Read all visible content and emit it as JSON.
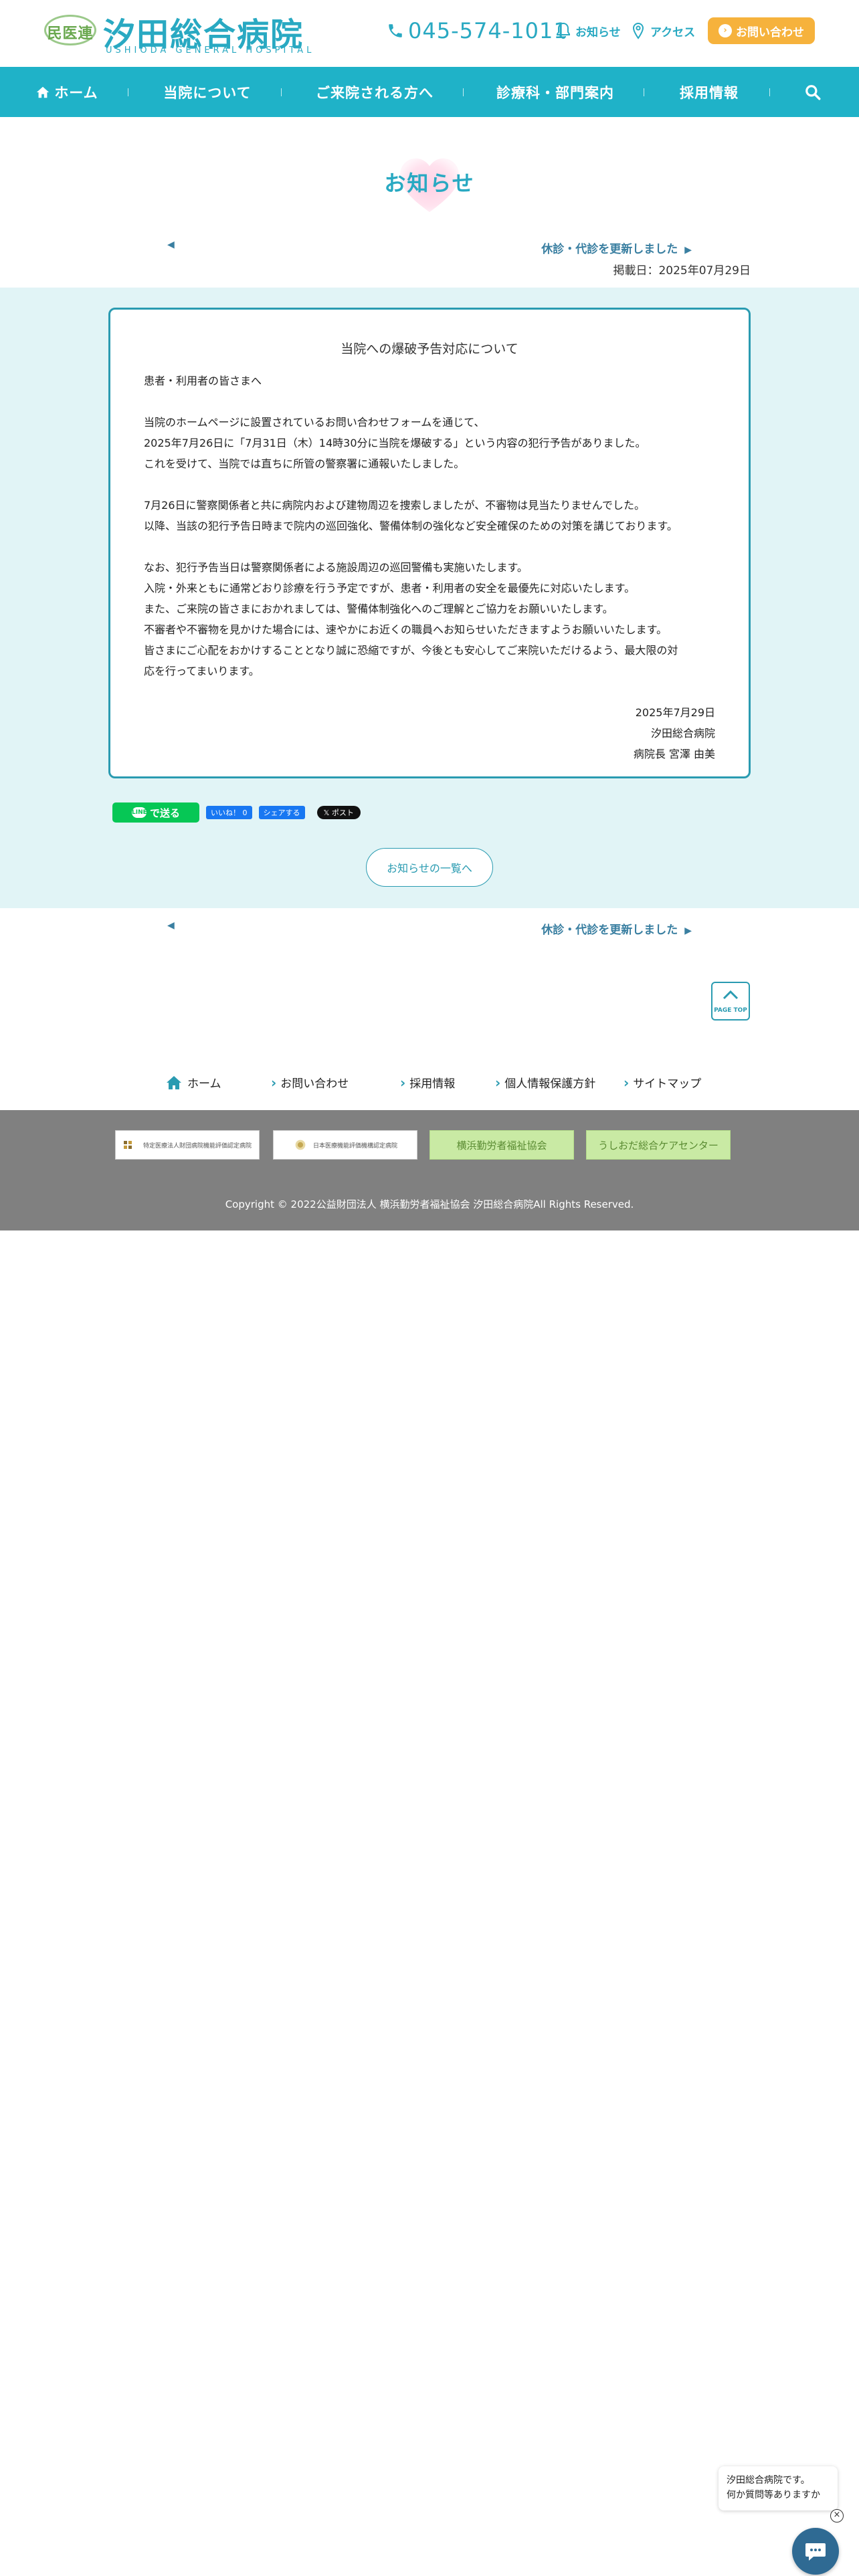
{
  "header": {
    "logo_badge": "民医連",
    "logo_name": "汐田総合病院",
    "logo_sub": "USHIODA GENERAL HOSPITAL",
    "tel": "045-574-1011",
    "news_label": "お知らせ",
    "access_label": "アクセス",
    "contact_label": "お問い合わせ",
    "contact_icon": "›"
  },
  "nav": {
    "items": [
      {
        "label": "ホーム"
      },
      {
        "label": "当院について"
      },
      {
        "label": "ご来院される方へ"
      },
      {
        "label": "診療科・部門案内"
      },
      {
        "label": "採用情報"
      }
    ]
  },
  "page": {
    "title": "お知らせ",
    "prev_arrow": "◀",
    "next_label": "休診・代診を更新しました",
    "next_arrow": "▶",
    "post_date": "掲載日：2025年07月29日"
  },
  "article": {
    "title": "当院への爆破予告対応について",
    "greeting": "患者・利用者の皆さまへ",
    "para1": [
      "当院のホームページに設置されているお問い合わせフォームを通じて、",
      "2025年7月26日に「7月31日（木）14時30分に当院を爆破する」という内容の犯行予告がありました。",
      "これを受けて、当院では直ちに所管の警察署に通報いたしました。"
    ],
    "para2": [
      "7月26日に警察関係者と共に病院内および建物周辺を捜索しましたが、不審物は見当たりませんでした。",
      "以降、当該の犯行予告日時まで院内の巡回強化、警備体制の強化など安全確保のための対策を講じております。"
    ],
    "para3": [
      "なお、犯行予告当日は警察関係者による施設周辺の巡回警備も実施いたします。",
      "入院・外来ともに通常どおり診療を行う予定ですが、患者・利用者の安全を最優先に対応いたします。",
      "また、ご来院の皆さまにおかれましては、警備体制強化へのご理解とご協力をお願いいたします。",
      "不審者や不審物を見かけた場合には、速やかにお近くの職員へお知らせいただきますようお願いいたします。",
      "皆さまにご心配をおかけすることとなり誠に恐縮ですが、今後とも安心してご来院いただけるよう、最大限の対",
      "応を行ってまいります。"
    ],
    "sign_date": "2025年7月29日",
    "sign_org": "汐田総合病院",
    "sign_name": "病院長 宮澤 由美"
  },
  "share": {
    "line_badge": "LINE",
    "line_label": "で送る",
    "fb_like": "いいね！ 0",
    "fb_share": "シェアする",
    "x_post": "𝕏 ポスト"
  },
  "list_button": "お知らせの一覧へ",
  "pagetop": "PAGE TOP",
  "footer_links": [
    {
      "label": "ホーム"
    },
    {
      "label": "お問い合わせ"
    },
    {
      "label": "採用情報"
    },
    {
      "label": "個人情報保護方針"
    },
    {
      "label": "サイトマップ"
    }
  ],
  "banners": [
    {
      "label": "特定医療法人財団病院機能評価認定病院"
    },
    {
      "label": "日本医療機能評価機構認定病院"
    },
    {
      "label": "横浜勤労者福祉協会"
    },
    {
      "label": "うしおだ総合ケアセンター"
    }
  ],
  "copyright": "Copyright © 2022公益財団法人 横浜勤労者福祉協会 汐田総合病院All Rights Reserved.",
  "chat": {
    "line1": "汐田総合病院です。",
    "line2": "何か質問等ありますか",
    "close": "×"
  },
  "colors": {
    "brand": "#29a9c2",
    "nav_bg": "#1fb2c8",
    "contact_orange": "#f6b23c",
    "section_bg": "#e1f4f6",
    "footer_gray": "#808080"
  }
}
